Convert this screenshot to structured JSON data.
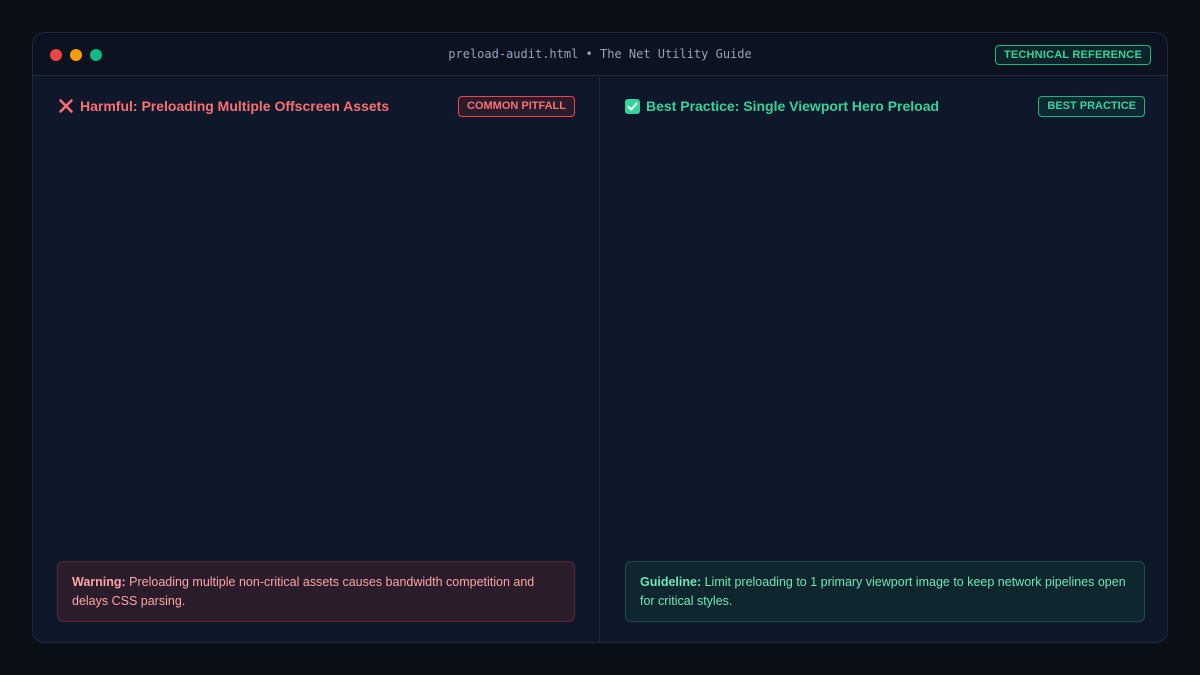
{
  "window": {
    "title": "preload-audit.html • The Net Utility Guide",
    "tag": "TECHNICAL REFERENCE"
  },
  "left_panel": {
    "icon": "x-icon",
    "title": "Harmful: Preloading Multiple Offscreen Assets",
    "badge": "COMMON PITFALL",
    "note_label": "Warning:",
    "note_text": " Preloading multiple non-critical assets causes bandwidth competition and delays CSS parsing."
  },
  "right_panel": {
    "icon": "check-icon",
    "title": "Best Practice: Single Viewport Hero Preload",
    "badge": "BEST PRACTICE",
    "note_label": "Guideline:",
    "note_text": " Limit preloading to 1 primary viewport image to keep network pipelines open for critical styles."
  },
  "colors": {
    "background": "#0b0f17",
    "panel": "#0f172a",
    "harmful": "#f87171",
    "good": "#34d399",
    "traffic_red": "#ef4444",
    "traffic_amber": "#f59e0b",
    "traffic_green": "#10b981"
  }
}
